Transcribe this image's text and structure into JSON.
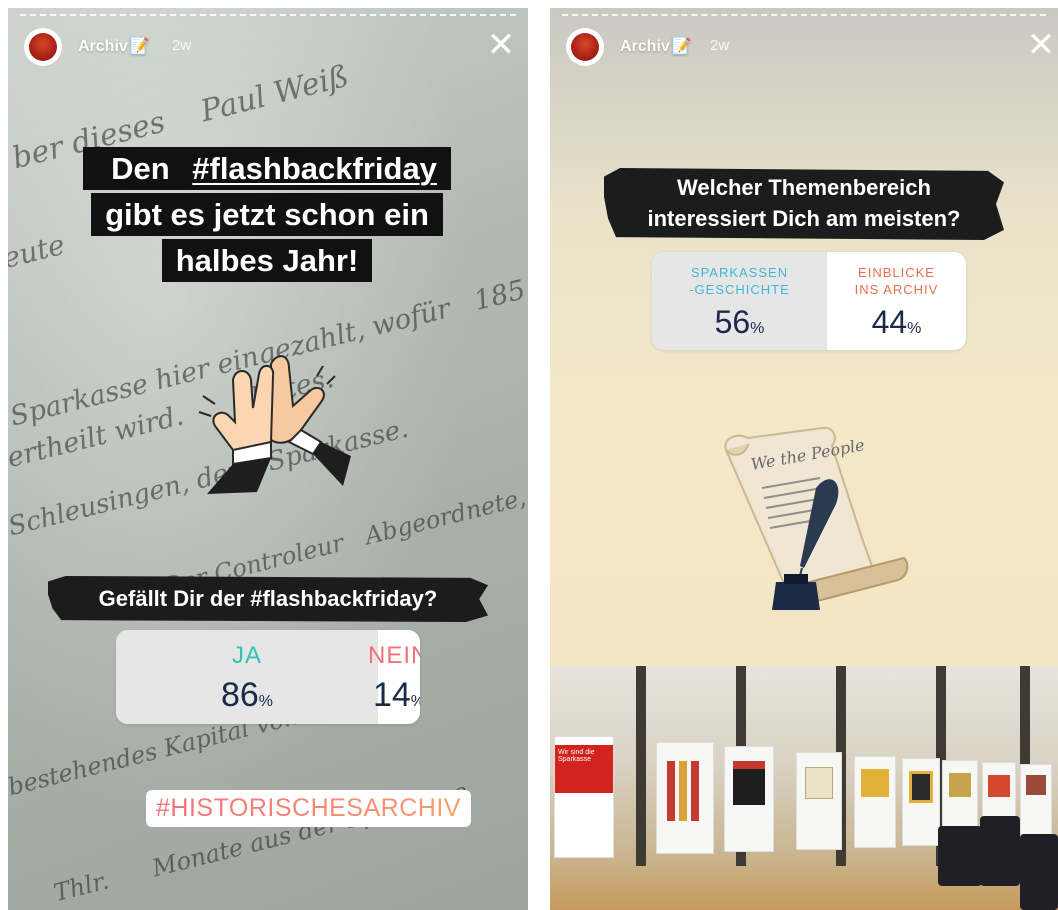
{
  "stories": [
    {
      "account": "Archiv",
      "account_badge": "📝",
      "age": "2w",
      "headline": {
        "line1_prefix": "Den ",
        "hashtag": "#flashbackfriday",
        "line2": "gibt es jetzt schon ein",
        "line3": "halbes Jahr!"
      },
      "poll": {
        "question": "Gefällt Dir der #flashbackfriday?",
        "options": [
          {
            "label": "JA",
            "percent": 86,
            "percent_text": "86",
            "color": "#33c3b8"
          },
          {
            "label": "NEIN",
            "percent": 14,
            "percent_text": "14",
            "color": "#f2707a"
          }
        ],
        "percent_sign": "%"
      },
      "hashtag_sticker": "#HISTORISCHESARCHIV"
    },
    {
      "account": "Archiv",
      "account_badge": "📝",
      "age": "2w",
      "poll": {
        "question_line1": "Welcher Themenbereich",
        "question_line2": "interessiert Dich am meisten?",
        "options": [
          {
            "label_line1": "SPARKASSEN",
            "label_line2": "-GESCHICHTE",
            "percent": 56,
            "percent_text": "56",
            "color": "#3fb6d8"
          },
          {
            "label_line1": "EINBLICKE",
            "label_line2": "INS ARCHIV",
            "percent": 44,
            "percent_text": "44",
            "color": "#e8704e"
          }
        ],
        "percent_sign": "%"
      },
      "photo_sign": {
        "line1": "Wir sind die",
        "line2": "Sparkasse"
      }
    }
  ],
  "icons": {
    "close": "✕",
    "clap": "clapping-hands-icon",
    "scroll": "document-quill-icon"
  },
  "colors": {
    "brand_red": "#b5291b",
    "poll_text": "#1b2a4a"
  }
}
